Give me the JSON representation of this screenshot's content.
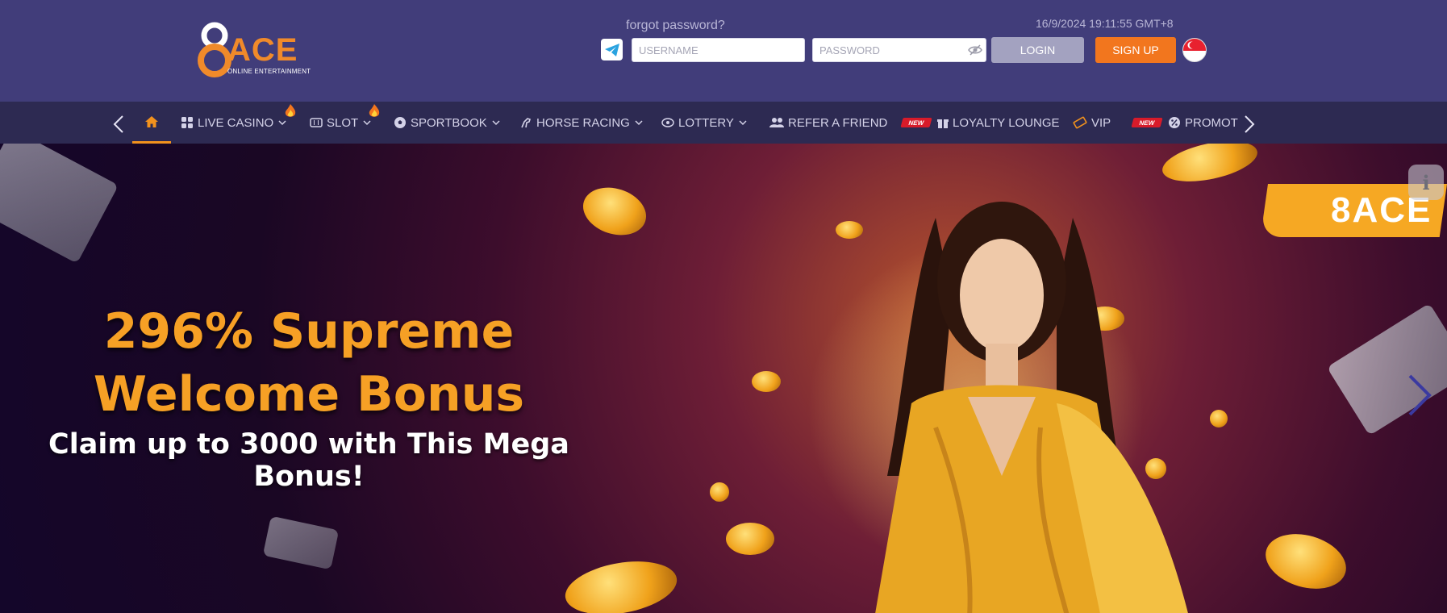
{
  "header": {
    "logo": {
      "mark": "8",
      "name": "ACE",
      "tagline": "ONLINE ENTERTAINMENT"
    },
    "forgot_password": "forgot password?",
    "datetime": "16/9/2024 19:11:55 GMT+8",
    "username_placeholder": "USERNAME",
    "password_placeholder": "PASSWORD",
    "login_label": "LOGIN",
    "signup_label": "SIGN UP",
    "language_flag": "Singapore",
    "colors": {
      "background": "#413d7a",
      "signup": "#f2761e",
      "login": "#a3a2c0"
    }
  },
  "nav": {
    "items": [
      {
        "label": "LIVE CASINO",
        "icon": "dice-icon",
        "dropdown": true,
        "badge": "hot"
      },
      {
        "label": "SLOT",
        "icon": "slot-icon",
        "dropdown": true,
        "badge": "hot"
      },
      {
        "label": "SPORTBOOK",
        "icon": "soccer-icon",
        "dropdown": true
      },
      {
        "label": "HORSE RACING",
        "icon": "horse-icon",
        "dropdown": true
      },
      {
        "label": "LOTTERY",
        "icon": "lottery-icon",
        "dropdown": true
      },
      {
        "label": "REFER A FRIEND",
        "icon": "users-icon"
      },
      {
        "label": "LOYALTY LOUNGE",
        "icon": "gift-icon",
        "badge": "new"
      },
      {
        "label": "VIP",
        "icon": "ticket-icon"
      },
      {
        "label": "PROMOTI",
        "icon": "promotion-icon",
        "badge": "new"
      }
    ],
    "new_badge_text": "NEW",
    "hot_badge_text": "HOT",
    "colors": {
      "background": "#2d2a52",
      "active": "#f2921d"
    }
  },
  "banner": {
    "headline_line1": "296% Supreme",
    "headline_line2": "Welcome Bonus",
    "subline": "Claim up to 3000 with This Mega Bonus!",
    "side_logo": "8ACE",
    "info_icon": "i",
    "colors": {
      "headline": "#f6a025"
    }
  }
}
